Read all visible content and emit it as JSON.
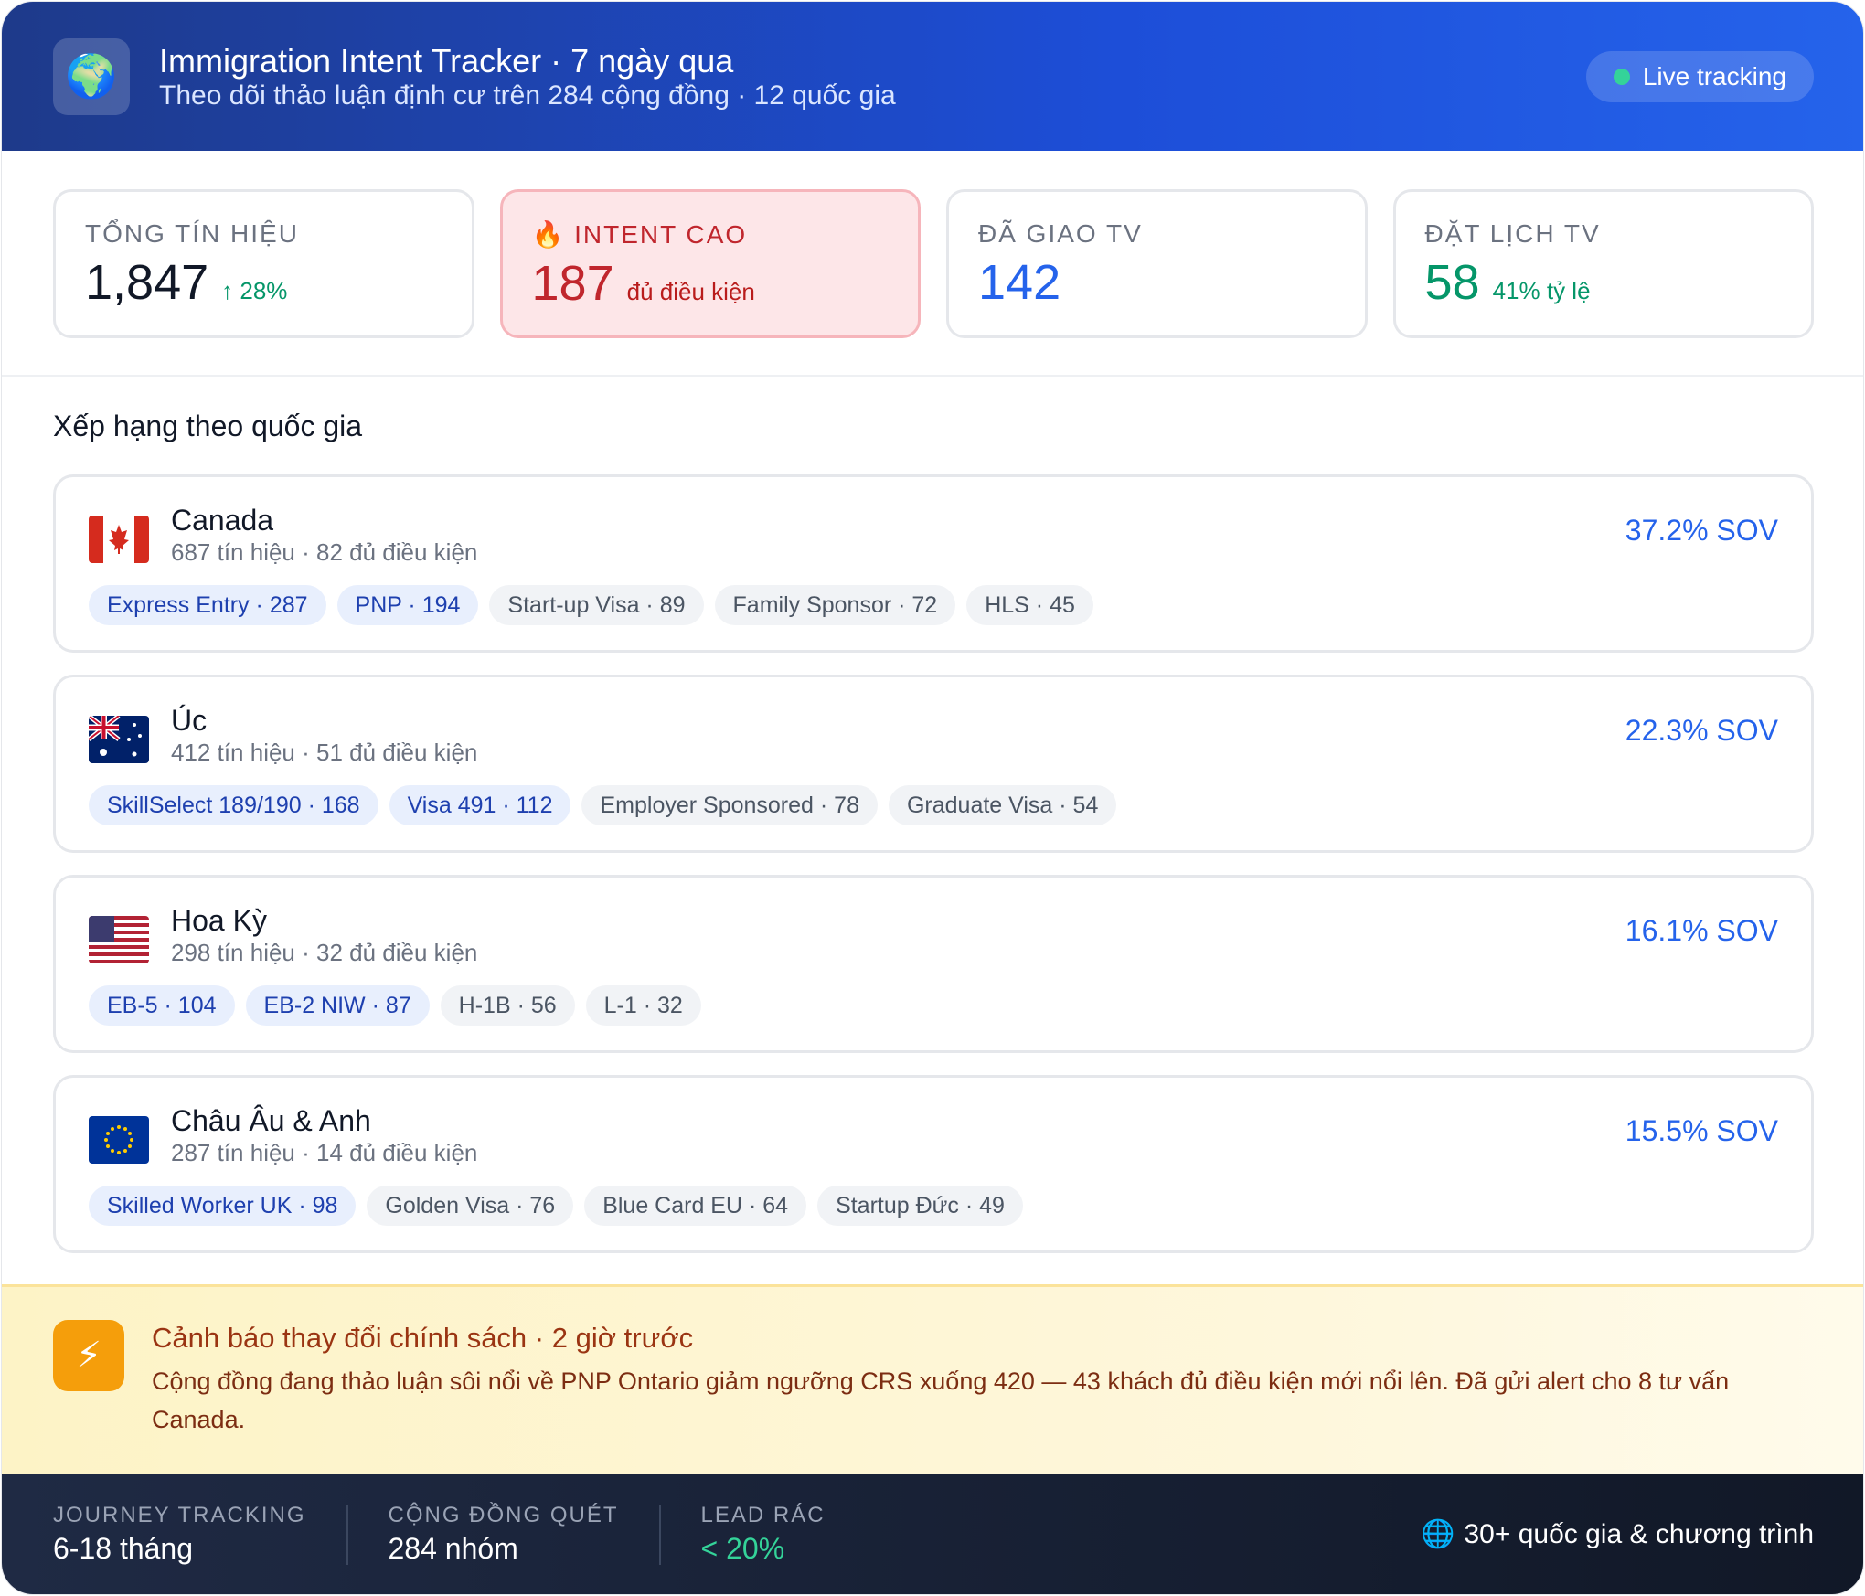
{
  "header": {
    "icon": "globe-icon",
    "title": "Immigration Intent Tracker · 7 ngày qua",
    "subtitle": "Theo dõi thảo luận định cư trên 284 cộng đồng · 12 quốc gia",
    "live_label": "Live tracking"
  },
  "stats": [
    {
      "label": "TỔNG TÍN HIỆU",
      "value": "1,847",
      "note": "↑ 28%"
    },
    {
      "label": "🔥 INTENT CAO",
      "value": "187",
      "note": "đủ điều kiện"
    },
    {
      "label": "ĐÃ GIAO TV",
      "value": "142",
      "note": ""
    },
    {
      "label": "ĐẶT LỊCH TV",
      "value": "58",
      "note": "41% tỷ lệ"
    }
  ],
  "ranking": {
    "title": "Xếp hạng theo quốc gia",
    "countries": [
      {
        "flag": "canada-flag-icon",
        "name": "Canada",
        "meta": "687 tín hiệu · 82 đủ điều kiện",
        "sov": "37.2% SOV",
        "chips": [
          "Express Entry · 287",
          "PNP · 194",
          "Start-up Visa · 89",
          "Family Sponsor · 72",
          "HLS · 45"
        ]
      },
      {
        "flag": "australia-flag-icon",
        "name": "Úc",
        "meta": "412 tín hiệu · 51 đủ điều kiện",
        "sov": "22.3% SOV",
        "chips": [
          "SkillSelect 189/190 · 168",
          "Visa 491 · 112",
          "Employer Sponsored · 78",
          "Graduate Visa · 54"
        ]
      },
      {
        "flag": "usa-flag-icon",
        "name": "Hoa Kỳ",
        "meta": "298 tín hiệu · 32 đủ điều kiện",
        "sov": "16.1% SOV",
        "chips": [
          "EB-5 · 104",
          "EB-2 NIW · 87",
          "H-1B · 56",
          "L-1 · 32"
        ]
      },
      {
        "flag": "eu-flag-icon",
        "name": "Châu Âu & Anh",
        "meta": "287 tín hiệu · 14 đủ điều kiện",
        "sov": "15.5% SOV",
        "chips": [
          "Skilled Worker UK · 98",
          "Golden Visa · 76",
          "Blue Card EU · 64",
          "Startup Đức · 49"
        ]
      }
    ]
  },
  "alert": {
    "icon": "lightning-icon",
    "title": "Cảnh báo thay đổi chính sách · 2 giờ trước",
    "text": "Cộng đồng đang thảo luận sôi nổi về PNP Ontario giảm ngưỡng CRS xuống 420 — 43 khách đủ điều kiện mới nổi lên. Đã gửi alert cho 8 tư vấn Canada."
  },
  "footer": {
    "items": [
      {
        "label": "JOURNEY TRACKING",
        "value": "6-18 tháng"
      },
      {
        "label": "CỘNG ĐỒNG QUÉT",
        "value": "284 nhóm"
      },
      {
        "label": "LEAD RÁC",
        "value": "< 20%"
      }
    ],
    "right_icon": "globe-grid-icon",
    "right_text": "30+ quốc gia & chương trình"
  },
  "colors": {
    "accent": "#2563eb",
    "danger": "#c0262d",
    "success": "#059669",
    "warning": "#f59e0b"
  }
}
